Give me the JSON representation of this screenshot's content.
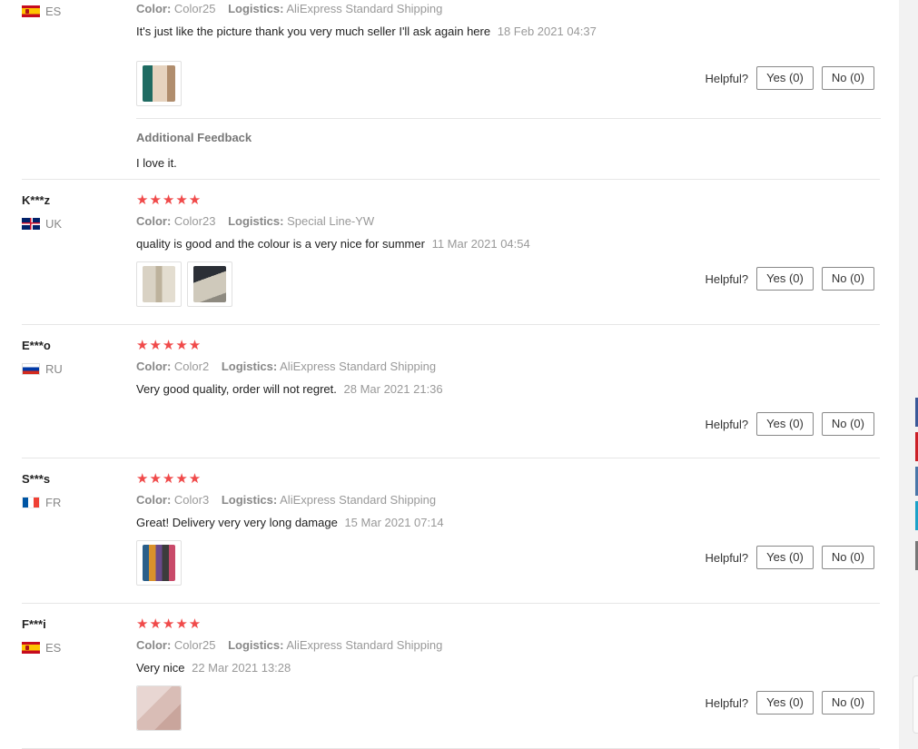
{
  "helpful_label": "Helpful?",
  "reviews": [
    {
      "user": "",
      "country": "ES",
      "stars": "★★★★★",
      "color_key": "Color:",
      "color_value": "Color25",
      "logistics_key": "Logistics:",
      "logistics_value": "AliExpress Standard Shipping",
      "text": "It's just like the picture thank you very much seller I'll ask again here",
      "date": "18 Feb 2021 04:37",
      "yes": "Yes (0)",
      "no": "No (0)",
      "additional_title": "Additional Feedback",
      "additional_text": "I love it."
    },
    {
      "user": "K***z",
      "country": "UK",
      "stars": "★★★★★",
      "color_key": "Color:",
      "color_value": "Color23",
      "logistics_key": "Logistics:",
      "logistics_value": "Special Line-YW",
      "text": "quality is good and the colour is a very nice for summer",
      "date": "11 Mar 2021 04:54",
      "yes": "Yes (0)",
      "no": "No (0)"
    },
    {
      "user": "E***o",
      "country": "RU",
      "stars": "★★★★★",
      "color_key": "Color:",
      "color_value": "Color2",
      "logistics_key": "Logistics:",
      "logistics_value": "AliExpress Standard Shipping",
      "text": "Very good quality, order will not regret.",
      "date": "28 Mar 2021 21:36",
      "yes": "Yes (0)",
      "no": "No (0)"
    },
    {
      "user": "S***s",
      "country": "FR",
      "stars": "★★★★★",
      "color_key": "Color:",
      "color_value": "Color3",
      "logistics_key": "Logistics:",
      "logistics_value": "AliExpress Standard Shipping",
      "text": "Great! Delivery very very long damage",
      "date": "15 Mar 2021 07:14",
      "yes": "Yes (0)",
      "no": "No (0)"
    },
    {
      "user": "F***i",
      "country": "ES",
      "stars": "★★★★★",
      "color_key": "Color:",
      "color_value": "Color25",
      "logistics_key": "Logistics:",
      "logistics_value": "AliExpress Standard Shipping",
      "text": "Very nice",
      "date": "22 Mar 2021 13:28",
      "yes": "Yes (0)",
      "no": "No (0)"
    }
  ],
  "colors": {
    "star": "#f04a4a",
    "divider": "#e6e6e6",
    "side_icons": [
      "#3b5998",
      "#cb2027",
      "#4a76a8",
      "#1da1c8",
      "#777777"
    ]
  }
}
